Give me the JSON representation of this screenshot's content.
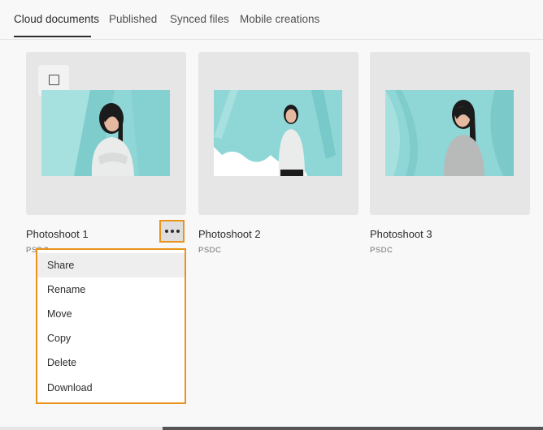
{
  "tabs": [
    {
      "label": "Cloud documents",
      "active": true
    },
    {
      "label": "Published",
      "active": false
    },
    {
      "label": "Synced files",
      "active": false
    },
    {
      "label": "Mobile creations",
      "active": false
    }
  ],
  "documents": [
    {
      "title": "Photoshoot 1",
      "type": "PSDC"
    },
    {
      "title": "Photoshoot 2",
      "type": "PSDC"
    },
    {
      "title": "Photoshoot 3",
      "type": "PSDC"
    }
  ],
  "more_button_icon": "more-horizontal-icon",
  "context_menu": {
    "items": [
      "Share",
      "Rename",
      "Move",
      "Copy",
      "Delete",
      "Download"
    ],
    "hovered": "Share"
  },
  "colors": {
    "highlight": "#e8941c",
    "teal_backdrop": "#8fd6d6"
  }
}
